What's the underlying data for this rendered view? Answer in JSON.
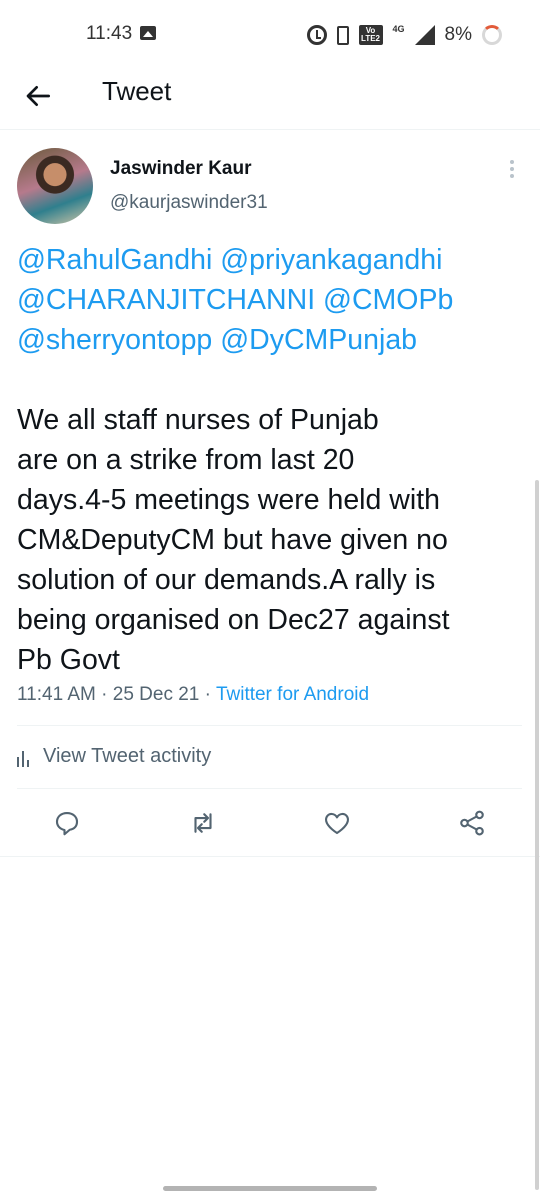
{
  "status_bar": {
    "time": "11:43",
    "network": "4G",
    "volte": "Vo LTE2",
    "battery": "8%"
  },
  "header": {
    "title": "Tweet"
  },
  "tweet": {
    "author_name": "Jaswinder Kaur",
    "author_handle": "@kaurjaswinder31",
    "mentions": [
      "@RahulGandhi @priyankagandhi",
      "@CHARANJITCHANNI @CMOPb",
      "@sherryontopp @DyCMPunjab"
    ],
    "body_lines": [
      "We all staff nurses of Punjab",
      "are on a strike from last 20",
      "days.4-5 meetings were held with",
      "CM&DeputyCM but have given no",
      "solution of our demands.A rally is",
      "being organised on Dec27 against",
      "Pb Govt"
    ],
    "time": "11:41 AM",
    "separator": "·",
    "date": "25 Dec 21",
    "source": "Twitter for Android"
  },
  "activity": {
    "label": "View Tweet activity"
  },
  "colors": {
    "link": "#1d9bf0",
    "text": "#0f1419",
    "secondary": "#536471",
    "divider": "#eff3f4"
  },
  "icons": {
    "back": "arrow-left-icon",
    "more": "more-vertical-icon",
    "reply": "reply-icon",
    "retweet": "retweet-icon",
    "like": "heart-icon",
    "share": "share-icon"
  }
}
